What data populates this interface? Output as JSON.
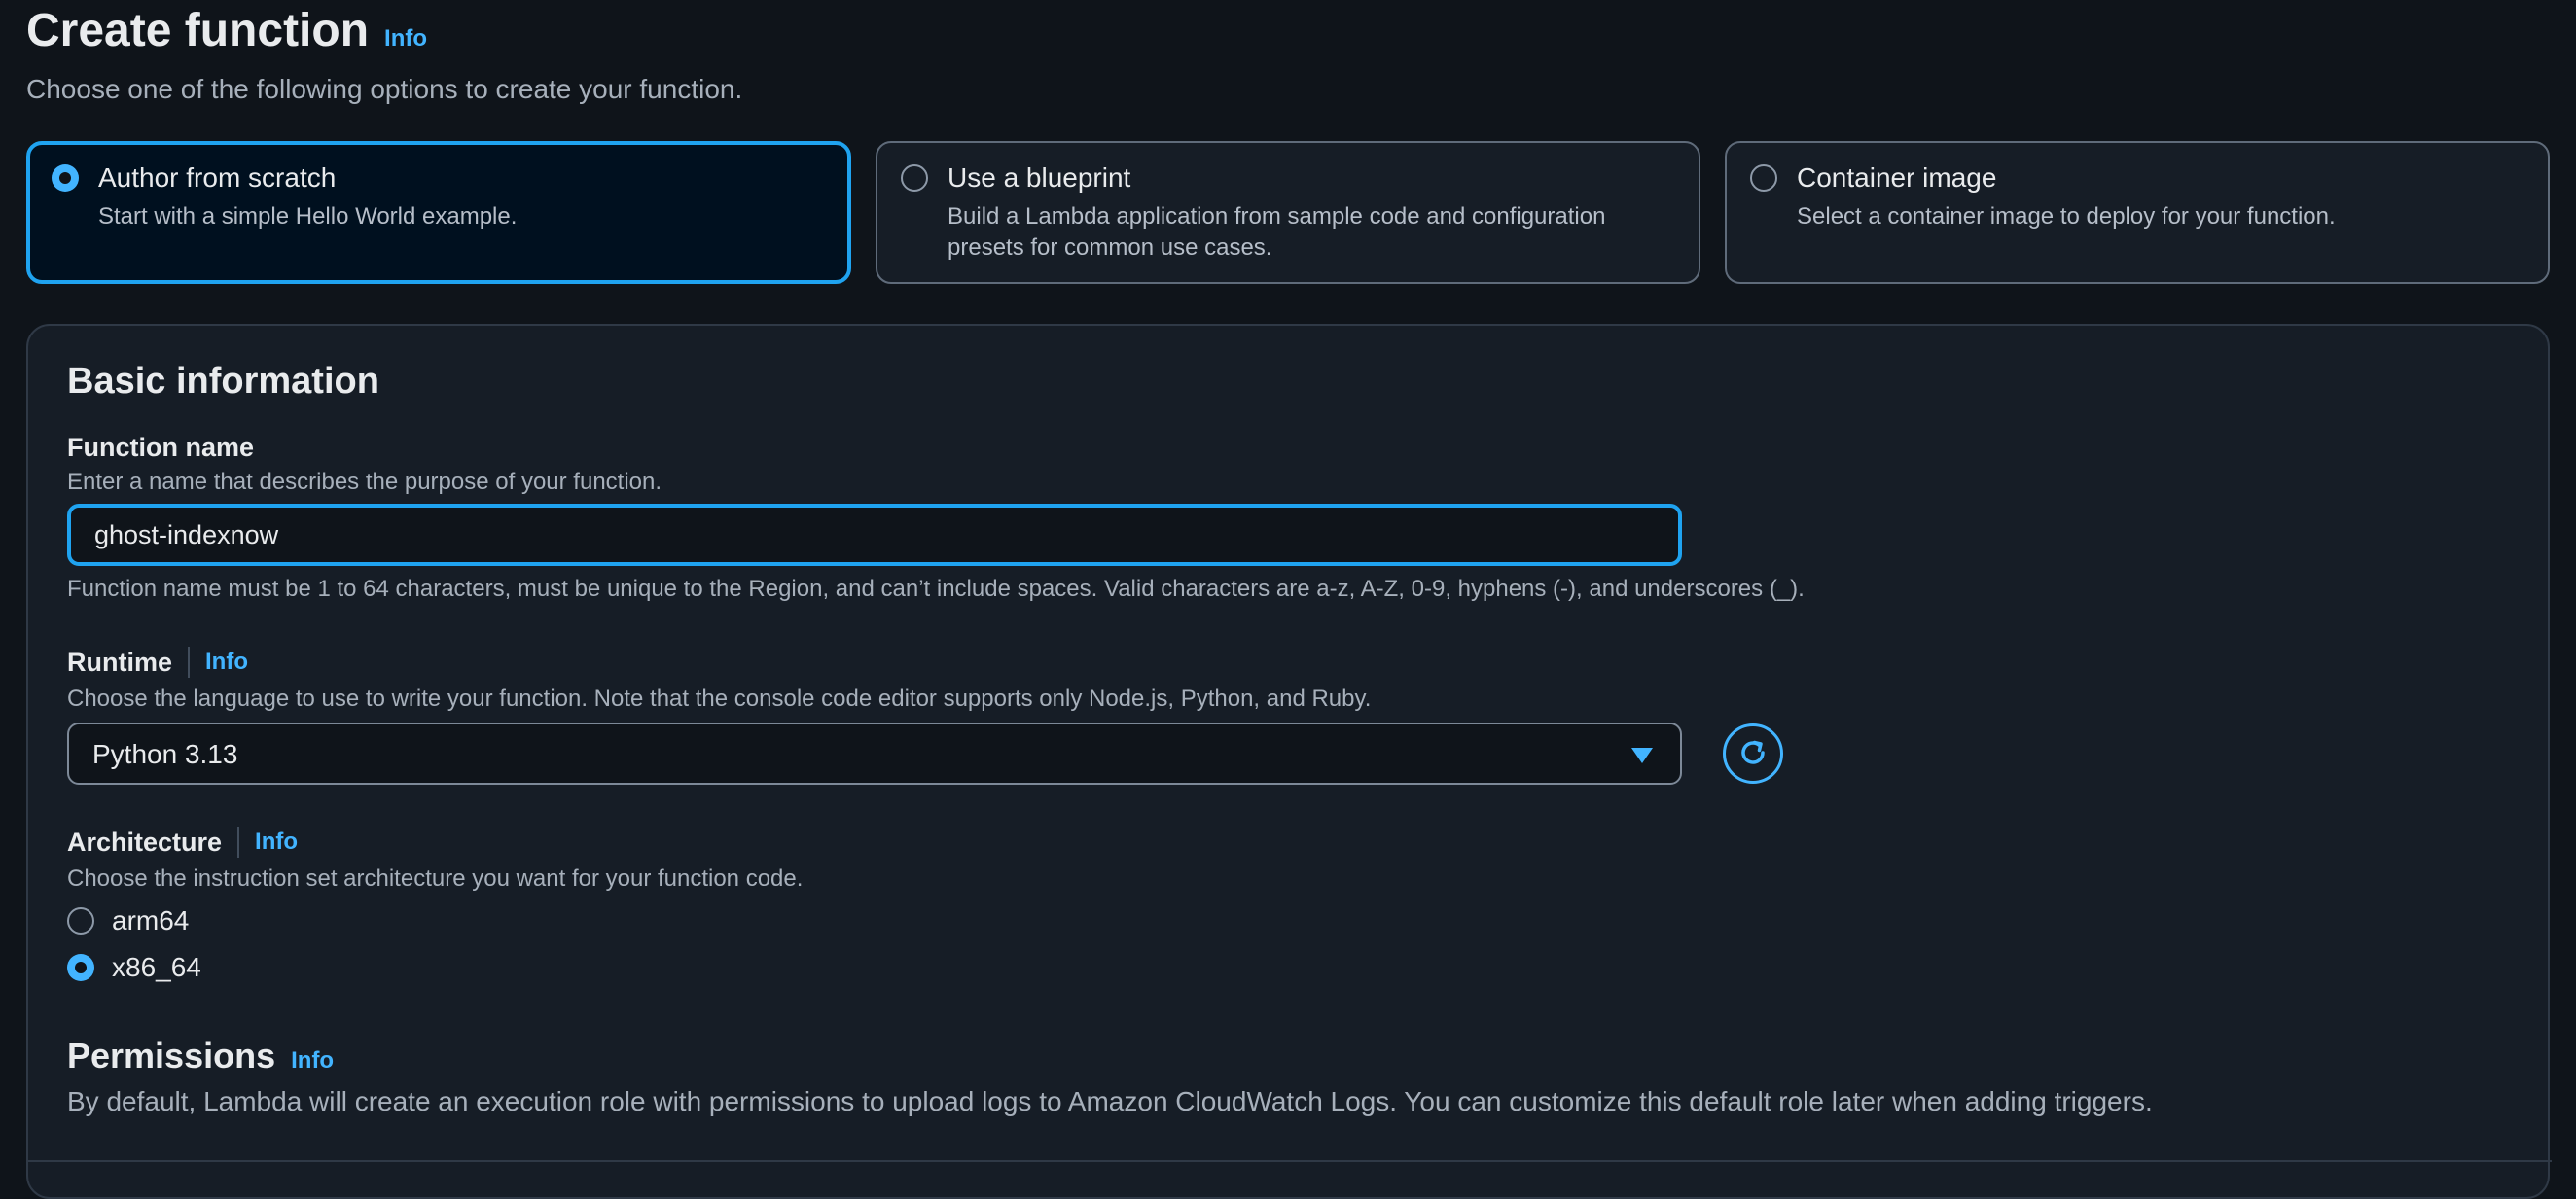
{
  "header": {
    "title": "Create function",
    "info": "Info",
    "subtitle": "Choose one of the following options to create your function."
  },
  "options": [
    {
      "label": "Author from scratch",
      "description": "Start with a simple Hello World example.",
      "selected": true
    },
    {
      "label": "Use a blueprint",
      "description": "Build a Lambda application from sample code and configuration presets for common use cases.",
      "selected": false
    },
    {
      "label": "Container image",
      "description": "Select a container image to deploy for your function.",
      "selected": false
    }
  ],
  "basic": {
    "title": "Basic information",
    "function_name": {
      "label": "Function name",
      "description": "Enter a name that describes the purpose of your function.",
      "value": "ghost-indexnow",
      "hint": "Function name must be 1 to 64 characters, must be unique to the Region, and can’t include spaces. Valid characters are a-z, A-Z, 0-9, hyphens (-), and underscores (_)."
    },
    "runtime": {
      "label": "Runtime",
      "info": "Info",
      "description": "Choose the language to use to write your function. Note that the console code editor supports only Node.js, Python, and Ruby.",
      "value": "Python 3.13"
    },
    "architecture": {
      "label": "Architecture",
      "info": "Info",
      "description": "Choose the instruction set architecture you want for your function code.",
      "options": [
        {
          "label": "arm64",
          "selected": false
        },
        {
          "label": "x86_64",
          "selected": true
        }
      ]
    }
  },
  "permissions": {
    "title": "Permissions",
    "info": "Info",
    "description": "By default, Lambda will create an execution role with permissions to upload logs to Amazon CloudWatch Logs. You can customize this default role later when adding triggers."
  },
  "colors": {
    "background": "#0f141a",
    "panel": "#161d26",
    "accent": "#42b4ff",
    "focus_border": "#1fa3f0"
  }
}
